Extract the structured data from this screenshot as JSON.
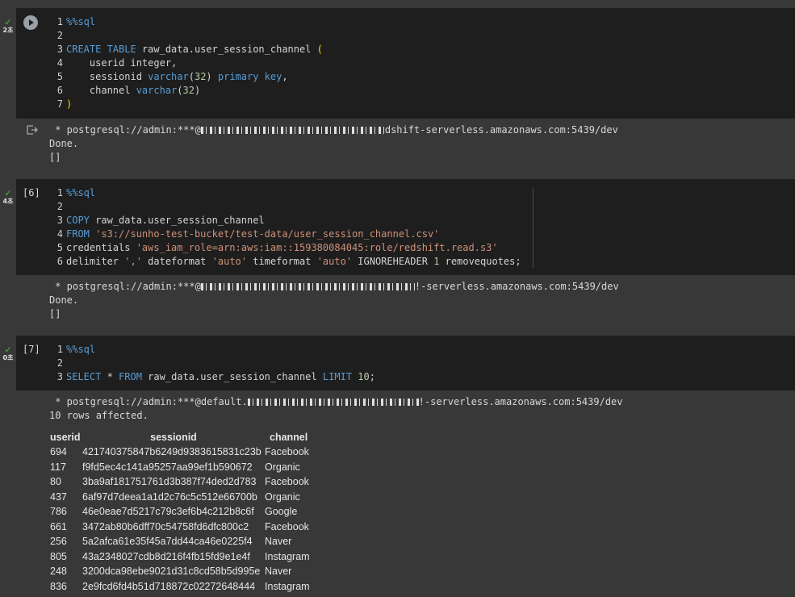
{
  "cells": [
    {
      "status_icon": "check-icon",
      "exec_time": "2초",
      "code": [
        {
          "n": "1",
          "text": "%%sql"
        },
        {
          "n": "2",
          "text": ""
        },
        {
          "n": "3",
          "text": "CREATE TABLE raw_data.user_session_channel ("
        },
        {
          "n": "4",
          "text": "    userid integer,"
        },
        {
          "n": "5",
          "text": "    sessionid varchar(32) primary key,"
        },
        {
          "n": "6",
          "text": "    channel varchar(32)"
        },
        {
          "n": "7",
          "text": ")"
        }
      ],
      "output": {
        "conn_prefix": " * postgresql://admin:***@",
        "conn_suffix": "dshift-serverless.amazonaws.com:5439/dev",
        "line2": "Done.",
        "line3": "[]"
      }
    },
    {
      "status_icon": "check-icon",
      "exec_time": "4초",
      "exec_count": "[6]",
      "code": [
        {
          "n": "1",
          "text": "%%sql"
        },
        {
          "n": "2",
          "text": ""
        },
        {
          "n": "3",
          "text": "COPY raw_data.user_session_channel"
        },
        {
          "n": "4",
          "text": "FROM 's3://sunho-test-bucket/test-data/user_session_channel.csv'"
        },
        {
          "n": "5",
          "text": "credentials 'aws_iam_role=arn:aws:iam::159380084045:role/redshift.read.s3'"
        },
        {
          "n": "6",
          "text": "delimiter ',' dateformat 'auto' timeformat 'auto' IGNOREHEADER 1 removequotes;"
        }
      ],
      "output": {
        "conn_prefix": " * postgresql://admin:***@",
        "conn_suffix": "!-serverless.amazonaws.com:5439/dev",
        "line2": "Done.",
        "line3": "[]"
      }
    },
    {
      "status_icon": "check-icon",
      "exec_time": "0초",
      "exec_count": "[7]",
      "code": [
        {
          "n": "1",
          "text": "%%sql"
        },
        {
          "n": "2",
          "text": ""
        },
        {
          "n": "3",
          "text": "SELECT * FROM raw_data.user_session_channel LIMIT 10;"
        }
      ],
      "output": {
        "conn_prefix": " * postgresql://admin:***@default.",
        "conn_suffix": "!-serverless.amazonaws.com:5439/dev",
        "line2": "10 rows affected."
      }
    }
  ],
  "result_table": {
    "headers": [
      "userid",
      "sessionid",
      "channel"
    ],
    "rows": [
      [
        "694",
        "421740375847b6249d9383615831c23b",
        "Facebook"
      ],
      [
        "117",
        "f9fd5ec4c141a95257aa99ef1b590672",
        "Organic"
      ],
      [
        "80",
        "3ba9af181751761d3b387f74ded2d783",
        "Facebook"
      ],
      [
        "437",
        "6af97d7deea1a1d2c76c5c512e66700b",
        "Organic"
      ],
      [
        "786",
        "46e0eae7d5217c79c3ef6b4c212b8c6f",
        "Google"
      ],
      [
        "661",
        "3472ab80b6dff70c54758fd6dfc800c2",
        "Facebook"
      ],
      [
        "256",
        "5a2afca61e35f45a7dd44ca46e0225f4",
        "Naver"
      ],
      [
        "805",
        "43a2348027cdb8d216f4fb15fd9e1e4f",
        "Instagram"
      ],
      [
        "248",
        "3200dca98ebe9021d31c8cd58b5d995e",
        "Naver"
      ],
      [
        "836",
        "2e9fcd6fd4b51d718872c02272648444",
        "Instagram"
      ]
    ]
  }
}
